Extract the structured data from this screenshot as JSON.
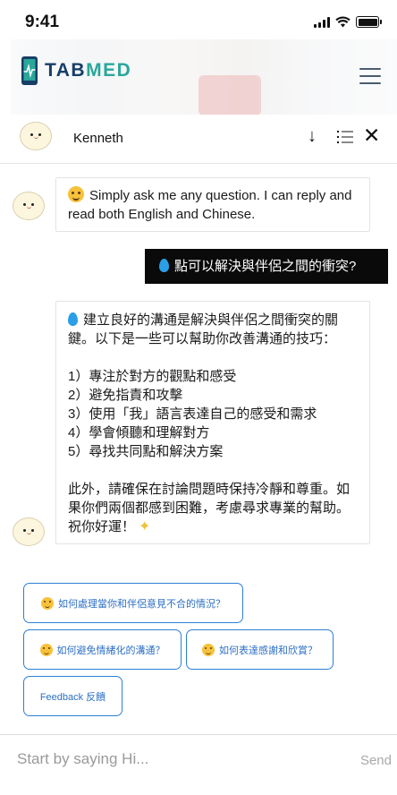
{
  "status_bar": {
    "time": "9:41"
  },
  "brand": {
    "name_part1": "TAB",
    "name_part2": "MED",
    "primary_color": "#173e66",
    "accent_color": "#2aa79b"
  },
  "chat": {
    "assistant_name": "Kenneth"
  },
  "messages": {
    "greeting": "Simply ask me any question. I can reply and read both English and Chinese.",
    "user_question": "點可以解決與伴侶之間的衝突?",
    "answer": "建立良好的溝通是解決與伴侶之間衝突的關鍵。以下是一些可以幫助你改善溝通的技巧：\n\n1）專注於對方的觀點和感受\n2）避免指責和攻擊\n3）使用「我」語言表達自己的感受和需求\n4）學會傾聽和理解對方\n5）尋找共同點和解決方案\n\n此外，請確保在討論問題時保持冷靜和尊重。如果你們兩個都感到困難，考慮尋求專業的幫助。祝你好運！"
  },
  "suggestions": [
    "如何處理當你和伴侶意見不合的情況？",
    "如何避免情緒化的溝通？",
    "如何表達感謝和欣賞？",
    "Feedback 反饋"
  ],
  "input": {
    "placeholder": "Start by saying Hi...",
    "send_label": "Send"
  },
  "colors": {
    "chip_border": "#2d7fd6",
    "user_bubble": "#0a0a0a",
    "water_drop": "#2a9ee6"
  }
}
